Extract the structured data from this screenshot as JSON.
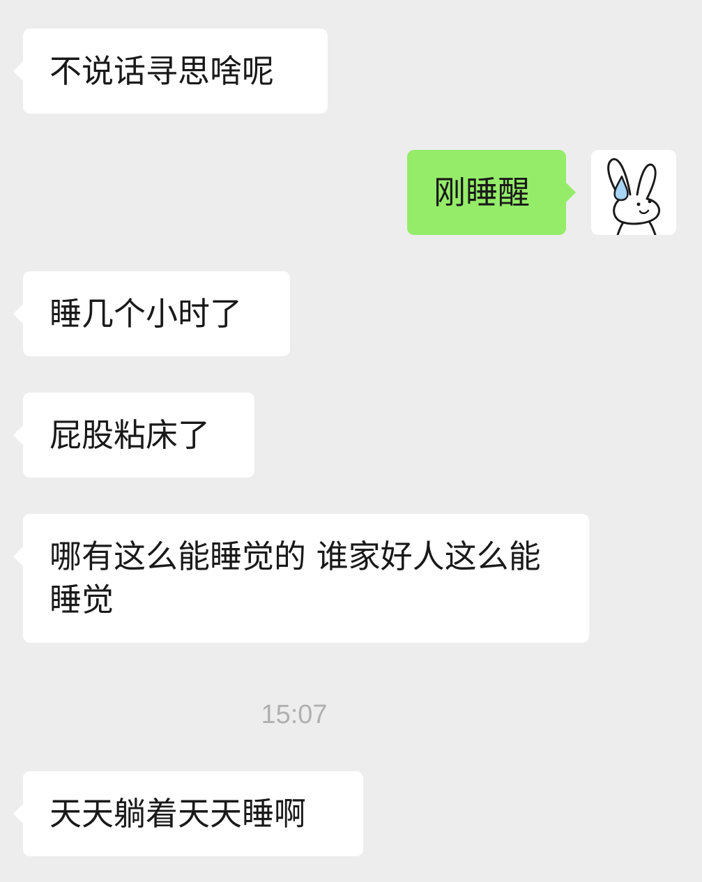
{
  "chat": {
    "messages": [
      {
        "side": "left",
        "text": "不说话寻思啥呢"
      },
      {
        "side": "right",
        "text": "刚睡醒"
      },
      {
        "side": "left",
        "text": "睡几个小时了"
      },
      {
        "side": "left",
        "text": "屁股粘床了"
      },
      {
        "side": "left",
        "text": "哪有这么能睡觉的 谁家好人这么能睡觉"
      },
      {
        "side": "left",
        "text": "天天躺着天天睡啊"
      }
    ],
    "timestamp": "15:07"
  },
  "avatar": {
    "icon": "bunny-sweat-drop-icon",
    "drop_color": "#a8d4f5"
  },
  "colors": {
    "background": "#ededed",
    "bubble_left": "#ffffff",
    "bubble_right": "#95ec69",
    "timestamp": "#b0b0b0"
  }
}
